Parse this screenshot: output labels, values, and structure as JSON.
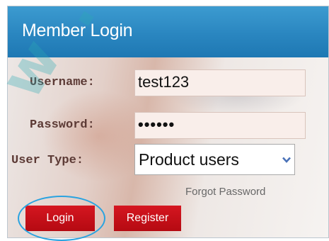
{
  "header": {
    "title": "Member Login"
  },
  "form": {
    "username_label": "Username:",
    "username_value": "test123",
    "password_label": "Password:",
    "password_value": "••••••",
    "user_type_label": "User Type:",
    "user_type_selected": "Product users",
    "forgot_password": "Forgot Password"
  },
  "buttons": {
    "login": "Login",
    "register": "Register"
  },
  "icons": {
    "select_arrow": "chevron-down-icon"
  },
  "colors": {
    "header": "#2a86c0",
    "button": "#c8101a",
    "highlight": "#2aa3e0"
  },
  "watermark": [
    "w",
    "."
  ]
}
